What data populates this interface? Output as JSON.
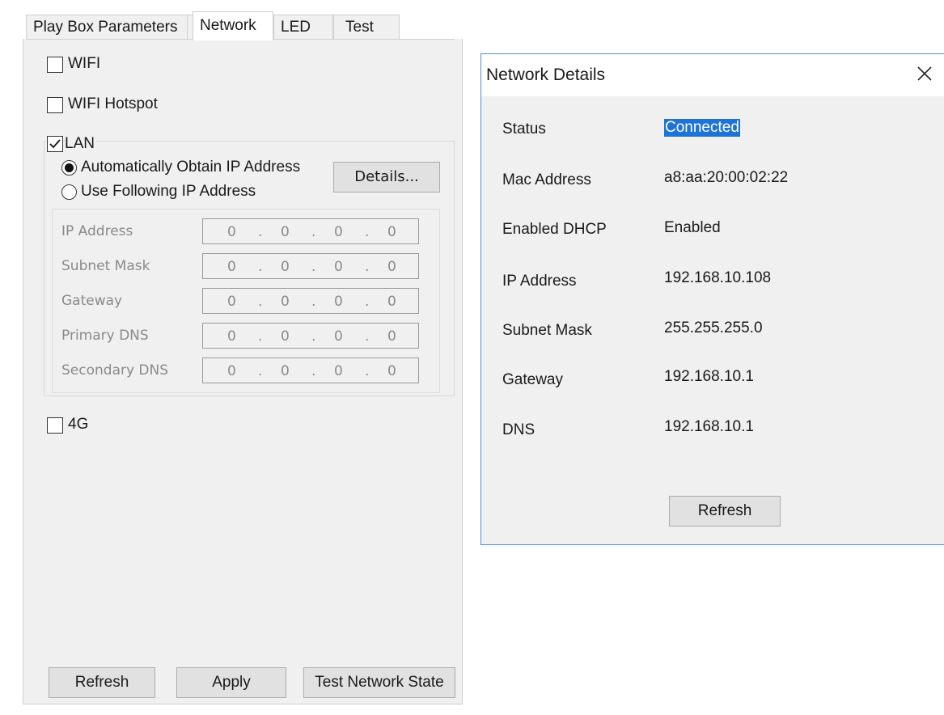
{
  "tabs": [
    {
      "label": "Play Box Parameters"
    },
    {
      "label": "Network"
    },
    {
      "label": "LED"
    },
    {
      "label": "Test"
    }
  ],
  "network": {
    "wifi": {
      "label": "WIFI",
      "checked": false
    },
    "hotspot": {
      "label": "WIFI Hotspot",
      "checked": false
    },
    "lan": {
      "label": "LAN",
      "checked": true
    },
    "auto_ip": {
      "label": "Automatically Obtain IP Address",
      "selected": true
    },
    "manual_ip": {
      "label": "Use Following IP Address",
      "selected": false
    },
    "details_button": "Details...",
    "fields": [
      {
        "label": "IP Address",
        "octets": [
          "0",
          "0",
          "0",
          "0"
        ]
      },
      {
        "label": "Subnet Mask",
        "octets": [
          "0",
          "0",
          "0",
          "0"
        ]
      },
      {
        "label": "Gateway",
        "octets": [
          "0",
          "0",
          "0",
          "0"
        ]
      },
      {
        "label": "Primary DNS",
        "octets": [
          "0",
          "0",
          "0",
          "0"
        ]
      },
      {
        "label": "Secondary DNS",
        "octets": [
          "0",
          "0",
          "0",
          "0"
        ]
      }
    ],
    "g4": {
      "label": "4G",
      "checked": false
    }
  },
  "footer": {
    "refresh": "Refresh",
    "apply": "Apply",
    "test": "Test Network State"
  },
  "dialog": {
    "title": "Network Details",
    "rows": [
      {
        "label": "Status",
        "value": "Connected"
      },
      {
        "label": "Mac Address",
        "value": "a8:aa:20:00:02:22"
      },
      {
        "label": "Enabled DHCP",
        "value": "Enabled"
      },
      {
        "label": "IP Address",
        "value": "192.168.10.108"
      },
      {
        "label": "Subnet Mask",
        "value": "255.255.255.0"
      },
      {
        "label": "Gateway",
        "value": "192.168.10.1"
      },
      {
        "label": "DNS",
        "value": "192.168.10.1"
      }
    ],
    "refresh": "Refresh"
  },
  "colors": {
    "selection": "#1e73d6",
    "dialog_border": "#4a8fd6",
    "panel_bg": "#f0f0f0",
    "disabled_text": "#8a8a8a"
  }
}
